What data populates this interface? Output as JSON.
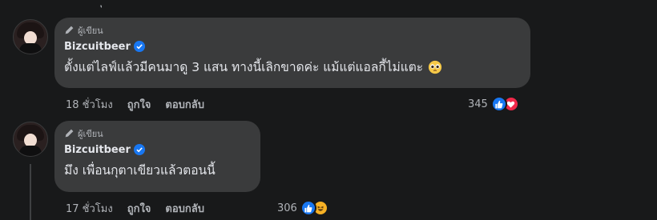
{
  "top_fragment": "ุ",
  "comments": [
    {
      "badge": "ผู้เขียน",
      "author": "Bizcuitbeer",
      "text": "ตั้งแต่ไลฟ์แล้วมีคนมาดู 3 แสน ทางนี้เลิกขาดค่ะ แม้แต่แอลกี้ไม่แตะ",
      "time": "18 ชั่วโมง",
      "like_label": "ถูกใจ",
      "reply_label": "ตอบกลับ",
      "reaction_count": "345"
    },
    {
      "badge": "ผู้เขียน",
      "author": "Bizcuitbeer",
      "text": "มึง เพื่อนกุตาเขียวแล้วตอนนี้",
      "time": "17 ชั่วโมง",
      "like_label": "ถูกใจ",
      "reply_label": "ตอบกลับ",
      "reaction_count": "306"
    }
  ],
  "colors": {
    "background": "#18191a",
    "bubble": "#3a3b3c",
    "verified": "#1877f2",
    "like": "#1877f2",
    "love": "#f02849",
    "haha": "#f7b125"
  }
}
